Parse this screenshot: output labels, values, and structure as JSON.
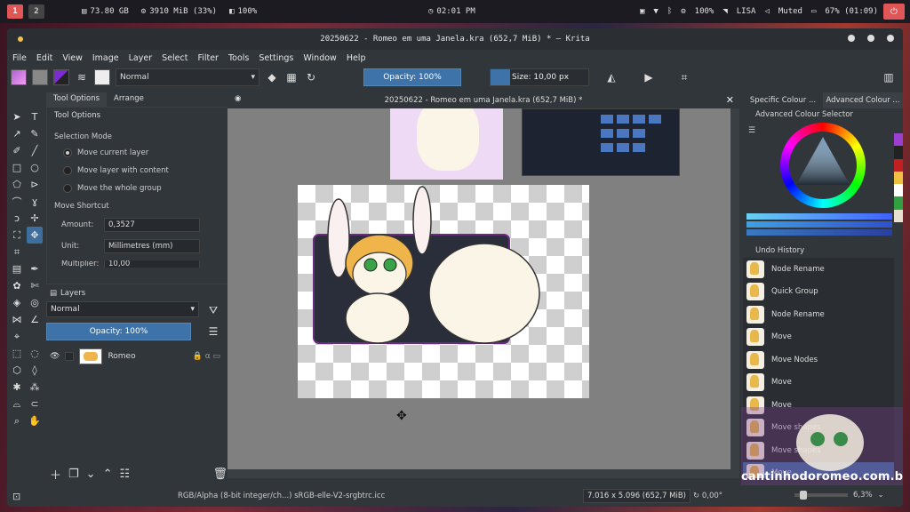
{
  "system_bar": {
    "workspace_active": "1",
    "workspace_inactive": "2",
    "disk": "73.80 GB",
    "memory": "3910 MiB (33%)",
    "brightness": "100%",
    "clock": "02:01 PM",
    "battery_ind": "100%",
    "wifi_name": "LISA",
    "volume": "Muted",
    "battery": "67% (01:09)"
  },
  "window": {
    "title": "20250622 - Romeo em uma Janela.kra (652,7 MiB) * — Krita"
  },
  "menu": [
    "File",
    "Edit",
    "View",
    "Image",
    "Layer",
    "Select",
    "Filter",
    "Tools",
    "Settings",
    "Window",
    "Help"
  ],
  "toolbar": {
    "blend_mode": "Normal",
    "opacity": "Opacity: 100%",
    "size": "Size: 10,00 px"
  },
  "tool_options": {
    "tabs": [
      "Tool Options",
      "Arrange"
    ],
    "title": "Tool Options",
    "selection_mode_label": "Selection Mode",
    "modes": [
      "Move current layer",
      "Move layer with content",
      "Move the whole group"
    ],
    "move_shortcut_label": "Move Shortcut",
    "amount_label": "Amount:",
    "amount_value": "0,3527",
    "unit_label": "Unit:",
    "unit_value": "Millimetres (mm)",
    "multiplier_label": "Multiplier:",
    "multiplier_value": "10,00"
  },
  "layers": {
    "header": "Layers",
    "blend": "Normal",
    "opacity": "Opacity:  100%",
    "items": [
      {
        "name": "Romeo"
      }
    ]
  },
  "document": {
    "tab_title": "20250622 - Romeo em uma Janela.kra (652,7 MiB) *"
  },
  "right_panel": {
    "tabs": [
      "Specific Colour ...",
      "Advanced Colour ..."
    ],
    "acs_title": "Advanced Colour Selector",
    "undo_title": "Undo History",
    "undo_items": [
      "Node Rename",
      "Quick Group",
      "Node Rename",
      "Move",
      "Move Nodes",
      "Move",
      "Move",
      "Move shapes",
      "Move shapes",
      "Move"
    ]
  },
  "watermark": "cantinhodoromeo.com.br",
  "status": {
    "color_profile": "RGB/Alpha (8-bit integer/ch...)   sRGB-elle-V2-srgbtrc.icc",
    "dimensions": "7.016 x 5.096 (652,7 MiB)",
    "rotation": "0,00°",
    "zoom": "6,3%"
  },
  "colors": {
    "accent": "#3d73a8",
    "window_bg": "#31363b",
    "canvas_bg": "#808080",
    "workspace_active": "#e05555"
  }
}
